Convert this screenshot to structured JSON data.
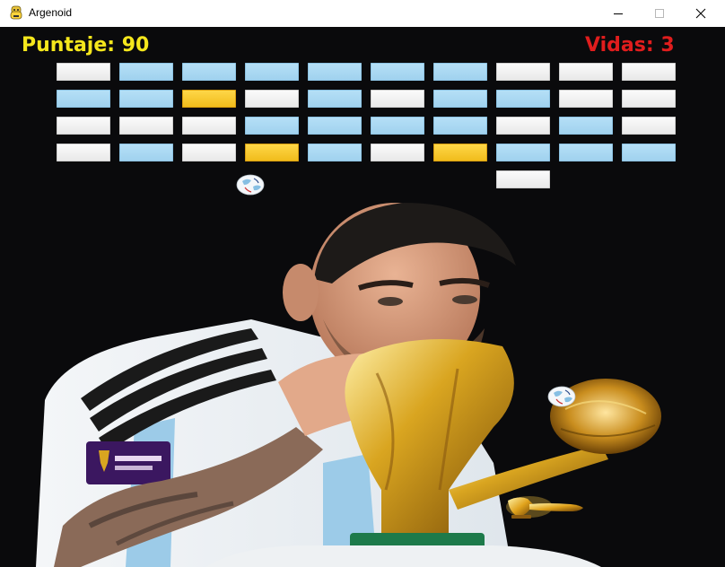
{
  "window": {
    "title": "Argenoid",
    "controls": {
      "minimize_icon": "minimize-icon",
      "maximize_icon": "maximize-icon",
      "close_icon": "close-icon"
    }
  },
  "hud": {
    "score_text": "Puntaje: 90",
    "lives_text": "Vidas: 3"
  },
  "colors": {
    "score": "#f5e71c",
    "lives": "#e01d1d",
    "brick_white": "#f0f0f0",
    "brick_celeste": "#a9d8f2",
    "brick_gold": "#f7c82a",
    "background": "#0a0a0c"
  },
  "bricks": {
    "rows": [
      [
        "white",
        "celeste",
        "celeste",
        "celeste",
        "celeste",
        "celeste",
        "celeste",
        "white",
        "white",
        "white"
      ],
      [
        "celeste",
        "celeste",
        "gold",
        "white",
        "celeste",
        "white",
        "celeste",
        "celeste",
        "white",
        "white"
      ],
      [
        "white",
        "white",
        "white",
        "celeste",
        "celeste",
        "celeste",
        "celeste",
        "white",
        "celeste",
        "white"
      ],
      [
        "white",
        "celeste",
        "white",
        "gold",
        "celeste",
        "white",
        "gold",
        "celeste",
        "celeste",
        "celeste"
      ],
      [
        "",
        "",
        "",
        "",
        "",
        "",
        "",
        "white",
        "",
        ""
      ]
    ]
  },
  "balls": [
    "ball-icon",
    "ball-icon"
  ],
  "paddle": {
    "icon": "trophy-paddle-icon"
  },
  "background_image": {
    "icon": "player-kissing-trophy-image"
  }
}
